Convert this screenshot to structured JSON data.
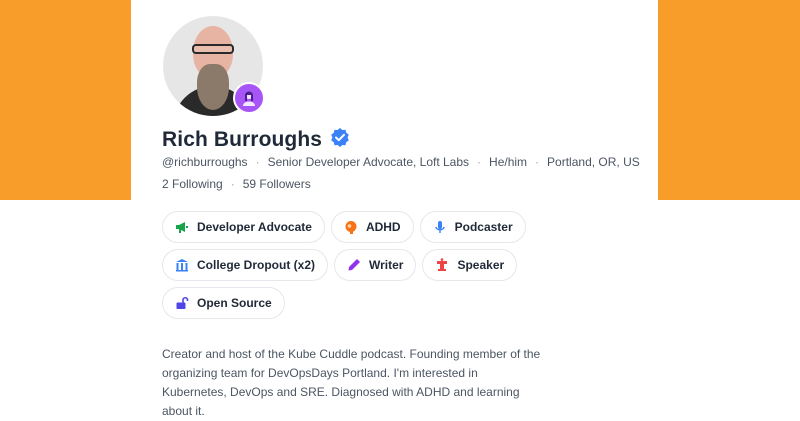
{
  "colors": {
    "banner": "#f89c2a",
    "verified": "#3b82f6",
    "badge": "#a855f7"
  },
  "profile": {
    "name": "Rich Burroughs",
    "verified_icon": "verified-check-icon",
    "handle": "@richburroughs",
    "title": "Senior Developer Advocate, Loft Labs",
    "pronouns": "He/him",
    "location": "Portland, OR, US",
    "following": "2 Following",
    "followers": "59 Followers",
    "separator": "·",
    "bio": "Creator and host of the Kube Cuddle podcast. Founding member of the organizing team for DevOpsDays Portland. I'm interested in Kubernetes, DevOps and SRE. Diagnosed with ADHD and learning about it."
  },
  "tags": [
    {
      "label": "Developer Advocate",
      "icon": "megaphone-icon"
    },
    {
      "label": "ADHD",
      "icon": "brain-icon"
    },
    {
      "label": "Podcaster",
      "icon": "microphone-icon"
    },
    {
      "label": "College Dropout (x2)",
      "icon": "building-icon"
    },
    {
      "label": "Writer",
      "icon": "pen-icon"
    },
    {
      "label": "Speaker",
      "icon": "podium-icon"
    },
    {
      "label": "Open Source",
      "icon": "unlock-icon"
    }
  ]
}
